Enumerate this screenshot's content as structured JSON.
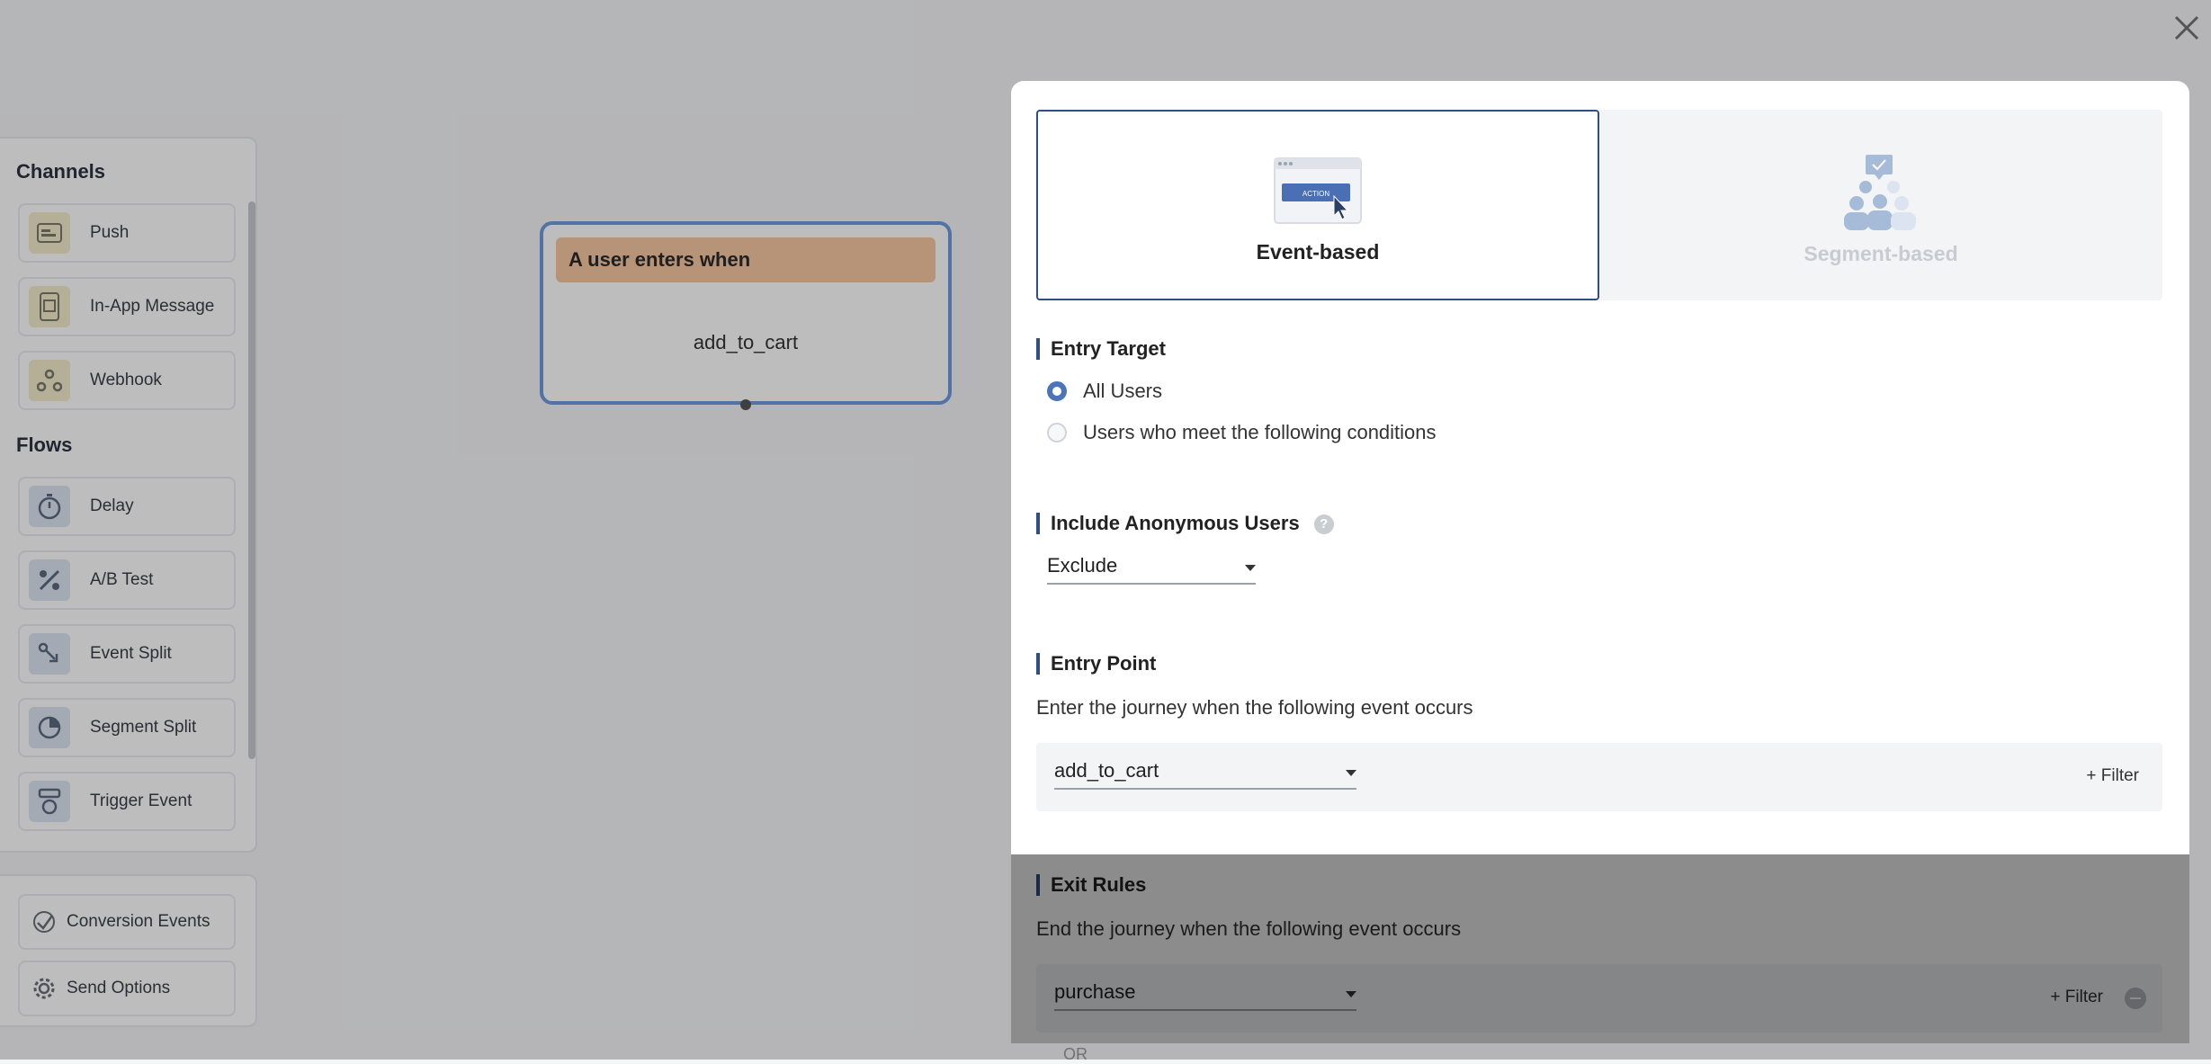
{
  "palette": {
    "channels_title": "Channels",
    "channels": [
      {
        "label": "Push",
        "icon": "push-icon"
      },
      {
        "label": "In-App Message",
        "icon": "in-app-message-icon"
      },
      {
        "label": "Webhook",
        "icon": "webhook-icon"
      }
    ],
    "flows_title": "Flows",
    "flows": [
      {
        "label": "Delay",
        "icon": "timer-icon"
      },
      {
        "label": "A/B Test",
        "icon": "percent-icon"
      },
      {
        "label": "Event Split",
        "icon": "event-split-icon"
      },
      {
        "label": "Segment Split",
        "icon": "segment-split-icon"
      },
      {
        "label": "Trigger Event",
        "icon": "trigger-event-icon"
      }
    ],
    "extras": [
      {
        "label": "Conversion Events",
        "icon": "conversion-icon"
      },
      {
        "label": "Send Options",
        "icon": "gear-icon"
      }
    ]
  },
  "canvas": {
    "node_header": "A user enters when",
    "node_event": "add_to_cart"
  },
  "panel": {
    "entry_types": [
      {
        "label": "Event-based",
        "selected": true,
        "art": "action-click-illustration"
      },
      {
        "label": "Segment-based",
        "selected": false,
        "art": "segment-people-illustration"
      }
    ],
    "entry_target": {
      "title": "Entry Target",
      "options": [
        {
          "label": "All Users",
          "selected": true
        },
        {
          "label": "Users who meet the following conditions",
          "selected": false
        }
      ]
    },
    "anonymous": {
      "title": "Include Anonymous Users",
      "help": "?",
      "value": "Exclude"
    },
    "entry_point": {
      "title": "Entry Point",
      "description": "Enter the journey when the following event occurs",
      "event": "add_to_cart",
      "filter_label": "+ Filter"
    },
    "exit_rules": {
      "title": "Exit Rules",
      "description": "End the journey when the following event occurs",
      "event": "purchase",
      "filter_label": "+ Filter",
      "or_label": "OR"
    },
    "art_text": "ACTION"
  },
  "colors": {
    "accent": "#2f4f80",
    "radio": "#4c74b8",
    "node_border": "#6f9be0",
    "node_header": "#f7c8a3"
  }
}
